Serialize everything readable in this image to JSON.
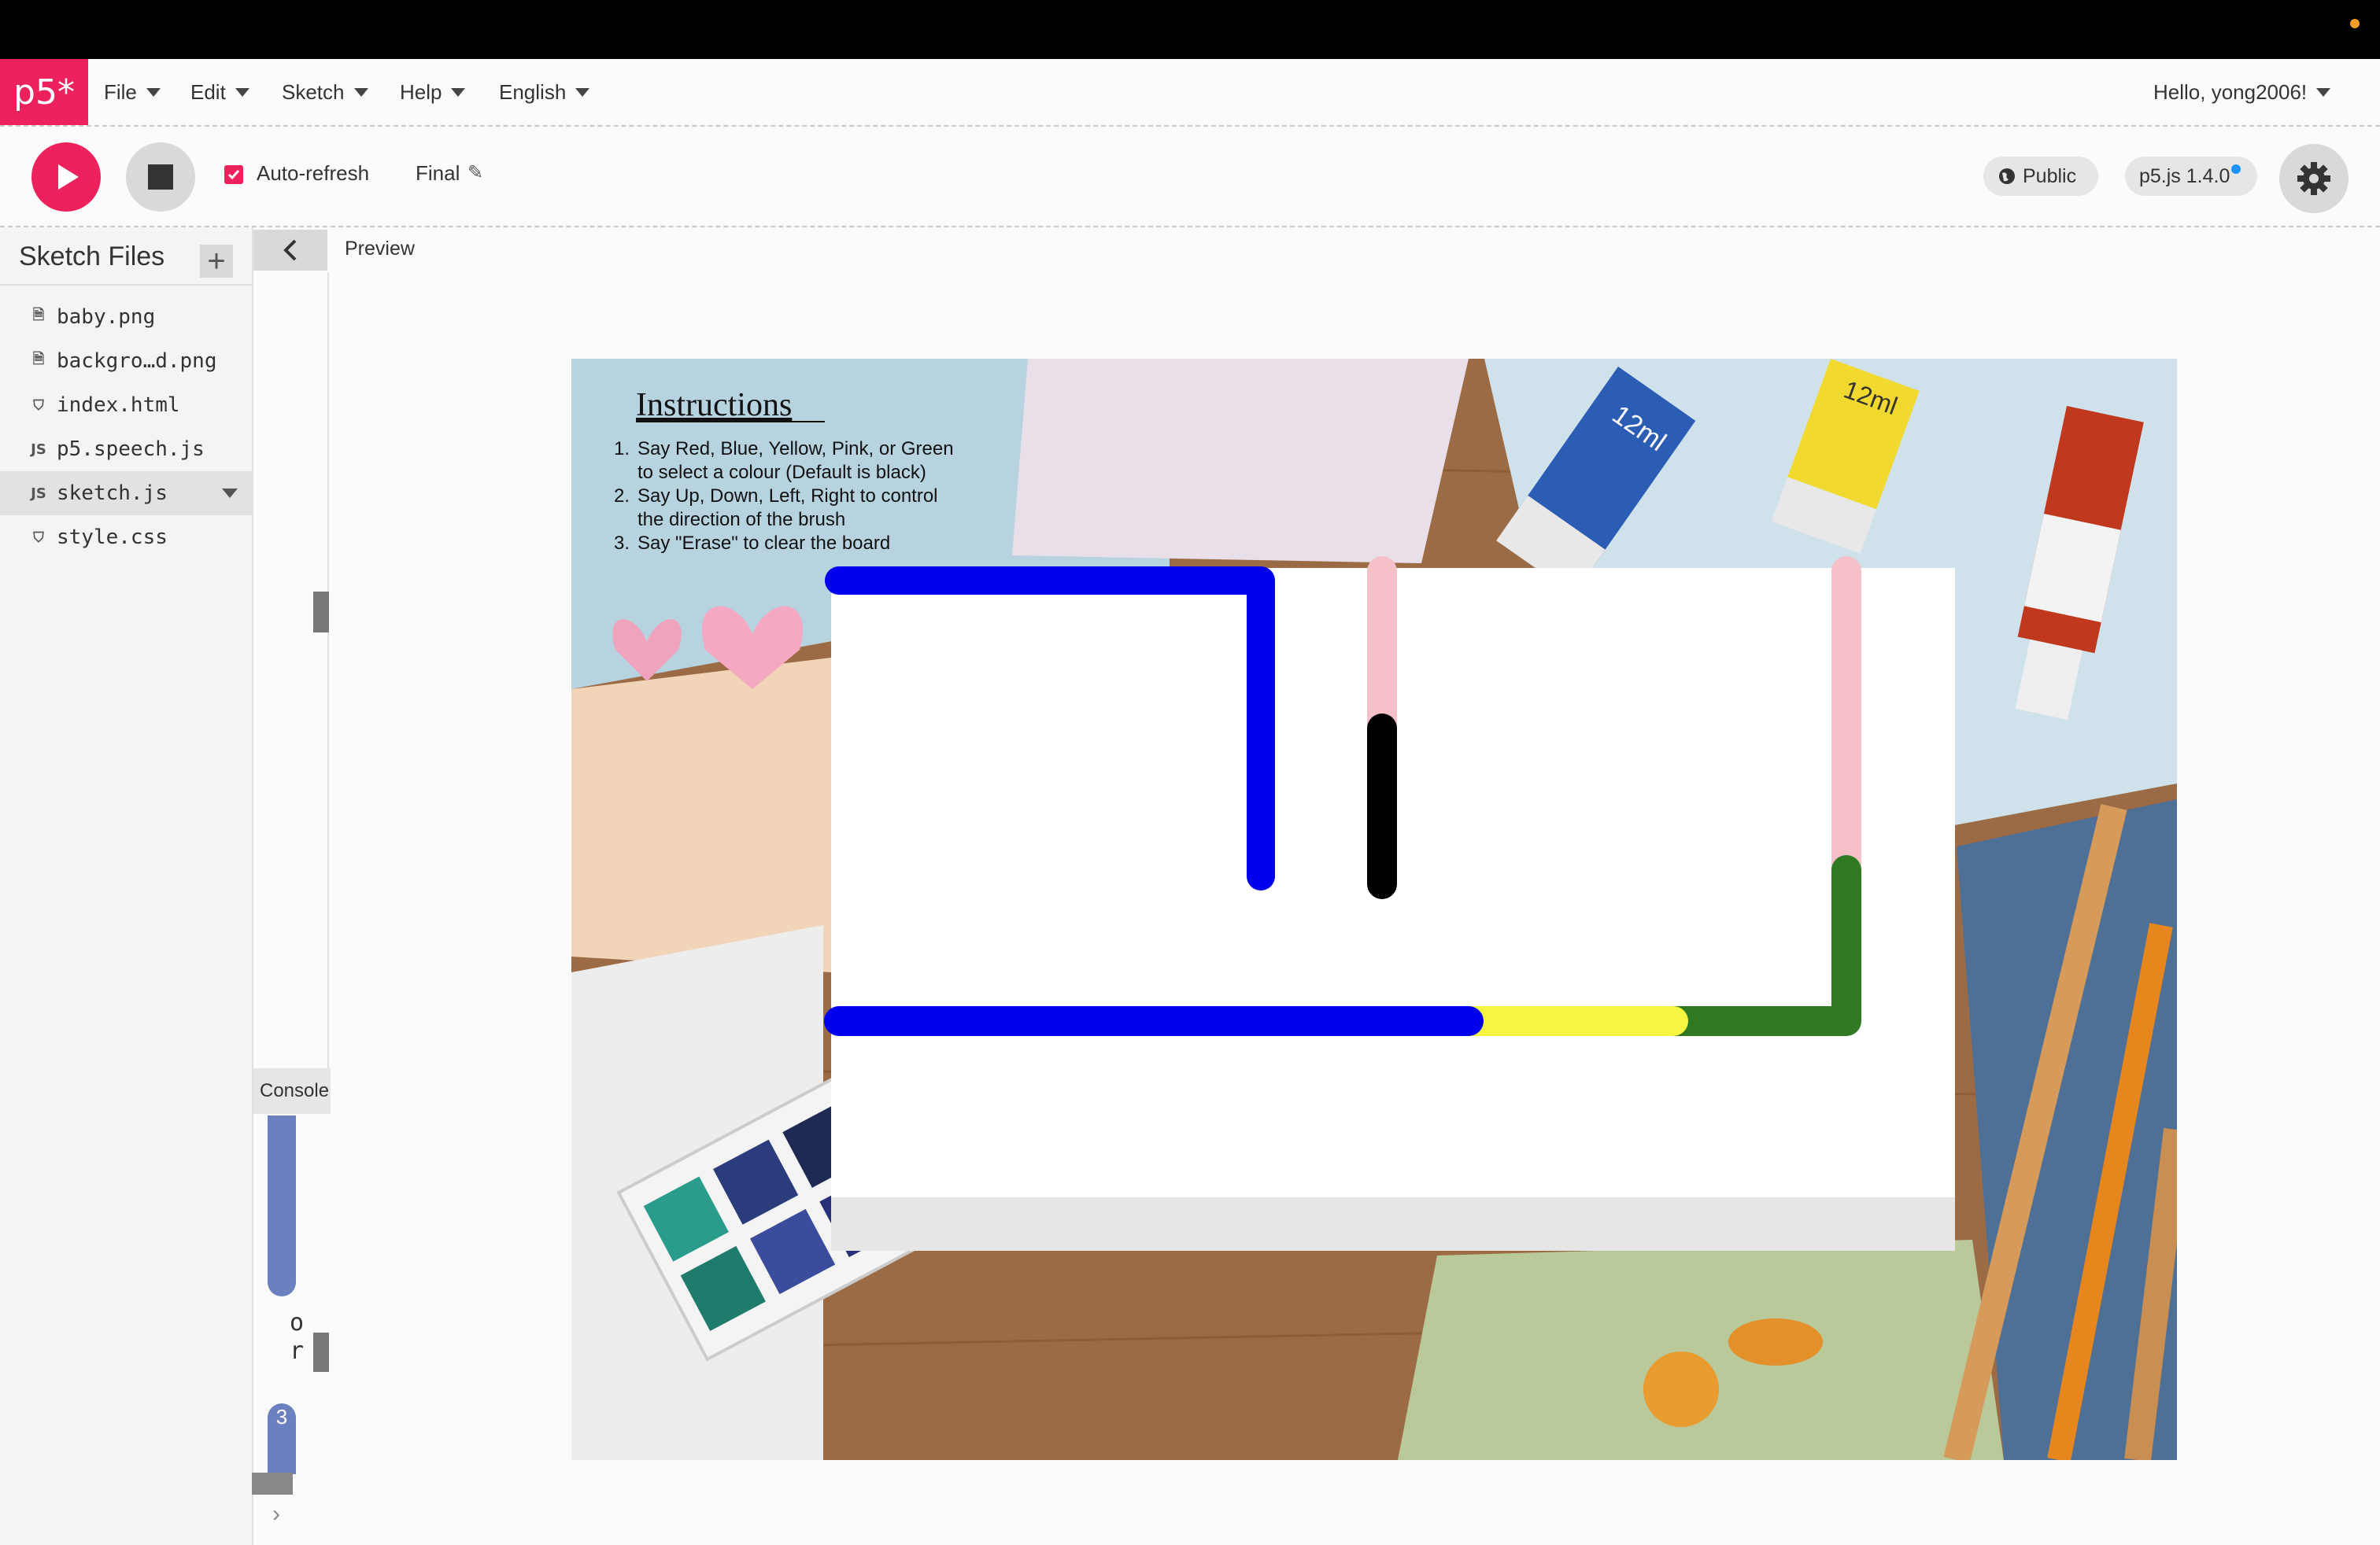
{
  "nav": {
    "logo_text": "p5*",
    "menus": [
      "File",
      "Edit",
      "Sketch",
      "Help",
      "English"
    ],
    "user_greeting": "Hello, yong2006!"
  },
  "toolbar": {
    "auto_refresh_label": "Auto-refresh",
    "auto_refresh_checked": true,
    "sketch_name": "Final",
    "visibility_label": "Public",
    "version_label": "p5.js 1.4.0"
  },
  "sidebar": {
    "title": "Sketch Files",
    "add_label": "+",
    "files": [
      {
        "name": "baby.png",
        "icon": "file-icon"
      },
      {
        "name": "backgro…d.png",
        "icon": "file-icon"
      },
      {
        "name": "index.html",
        "icon": "html-file-icon"
      },
      {
        "name": "p5.speech.js",
        "icon": "js-file-icon"
      },
      {
        "name": "sketch.js",
        "icon": "js-file-icon",
        "active": true
      },
      {
        "name": "style.css",
        "icon": "css-file-icon"
      }
    ]
  },
  "console": {
    "label": "Console",
    "letter_o": "o",
    "letter_r": "r",
    "badge": "3"
  },
  "preview": {
    "label": "Preview",
    "instructions": {
      "title": "Instructions",
      "items": [
        "Say Red, Blue, Yellow, Pink, or Green",
        "to select a colour (Default is black)",
        "Say Up, Down, Left, Right to control",
        "the direction of the brush",
        "Say \"Erase\" to clear the board"
      ],
      "numbers": [
        "1.",
        "2.",
        "3."
      ]
    },
    "tube_labels": [
      "12ml",
      "12ml"
    ],
    "stroke_colors": {
      "blue": "#0000ee",
      "pink": "#f5c0c8",
      "black": "#000000",
      "yellow": "#f5f542",
      "green": "#2f7a22"
    }
  },
  "colors": {
    "accent": "#ed225d",
    "link_blue": "#1e90ff"
  }
}
